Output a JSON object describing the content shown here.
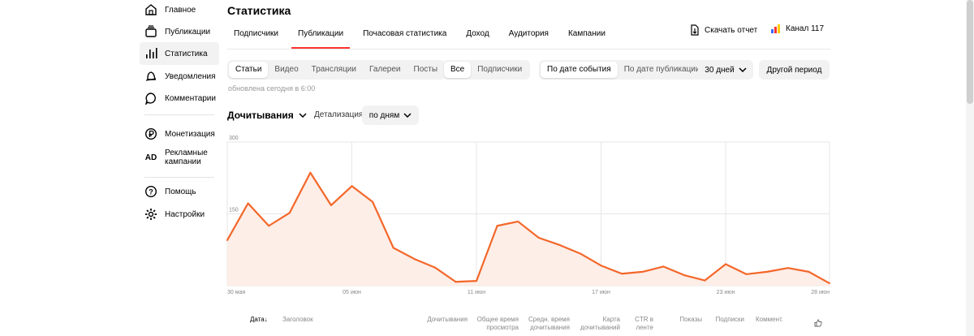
{
  "sidebar": {
    "items": [
      {
        "label": "Главное",
        "icon": "home-icon"
      },
      {
        "label": "Публикации",
        "icon": "publications-icon"
      },
      {
        "label": "Статистика",
        "icon": "statistics-icon"
      },
      {
        "label": "Уведомления",
        "icon": "bell-icon"
      },
      {
        "label": "Комментарии",
        "icon": "comment-icon"
      },
      {
        "label": "Монетизация",
        "icon": "ruble-icon"
      },
      {
        "label": "Рекламные\nкампании",
        "icon": "ad-icon",
        "icon_text": "AD"
      },
      {
        "label": "Помощь",
        "icon": "help-icon"
      },
      {
        "label": "Настройки",
        "icon": "gear-icon"
      }
    ],
    "active_index": 2
  },
  "header": {
    "title": "Статистика",
    "tabs": [
      "Подписчики",
      "Публикации",
      "Почасовая статистика",
      "Доход",
      "Аудитория",
      "Кампании"
    ],
    "active_tab": 1,
    "download_label": "Скачать отчет",
    "channel_label": "Канал 117"
  },
  "filters": {
    "content_types": [
      "Статьи",
      "Видео",
      "Трансляции",
      "Галереи",
      "Посты"
    ],
    "audience": [
      "Все",
      "Подписчики"
    ],
    "date_mode": [
      "По дате события",
      "По дате публикации"
    ],
    "period": "30 дней",
    "other_period": "Другой период",
    "updated": "обновлена сегодня в 6:00"
  },
  "metric": {
    "name": "Дочитывания",
    "detail_label": "Детализация",
    "detail_value": "по дням"
  },
  "chart_data": {
    "type": "area",
    "x_tick_labels": [
      "30 мая",
      "05 июн",
      "11 июн",
      "17 июн",
      "23 июн",
      "28 июн"
    ],
    "y_ticks": [
      0,
      150,
      300
    ],
    "ylim": [
      0,
      300
    ],
    "x": [
      "30 мая",
      "31 мая",
      "01 июн",
      "02 июн",
      "03 июн",
      "04 июн",
      "05 июн",
      "06 июн",
      "07 июн",
      "08 июн",
      "09 июн",
      "10 июн",
      "11 июн",
      "12 июн",
      "13 июн",
      "14 июн",
      "15 июн",
      "16 июн",
      "17 июн",
      "18 июн",
      "19 июн",
      "20 июн",
      "21 июн",
      "22 июн",
      "23 июн",
      "24 июн",
      "25 июн",
      "26 июн",
      "27 июн",
      "28 июн"
    ],
    "values": [
      95,
      172,
      125,
      152,
      236,
      168,
      208,
      175,
      79,
      56,
      38,
      8,
      10,
      125,
      134,
      100,
      85,
      67,
      42,
      25,
      29,
      40,
      22,
      11,
      45,
      24,
      29,
      37,
      29,
      5
    ],
    "grid": true,
    "colors": {
      "line": "#f4672a",
      "fill": "#fdeee7"
    }
  },
  "table": {
    "headers": [
      "Дата",
      "Заголовок",
      "Дочитывания",
      "Общее время просмотра",
      "Средн. время дочитывания",
      "Карта дочитываний",
      "CTR в ленте",
      "Показы",
      "Подписки",
      "Коммент."
    ],
    "sort_arrow": "↓"
  },
  "colors": {
    "accent_red": "#ff3333",
    "chart_line": "#f4672a"
  }
}
